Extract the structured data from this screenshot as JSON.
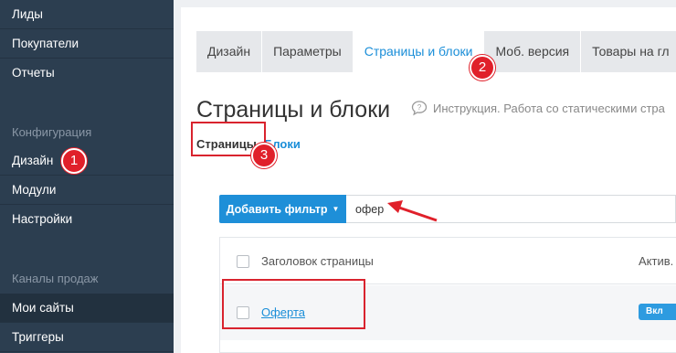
{
  "sidebar": {
    "items_top": [
      {
        "label": "Лиды"
      },
      {
        "label": "Покупатели"
      },
      {
        "label": "Отчеты"
      }
    ],
    "section_config": "Конфигурация",
    "items_config": [
      {
        "label": "Дизайн"
      },
      {
        "label": "Модули"
      },
      {
        "label": "Настройки"
      }
    ],
    "section_channels": "Каналы продаж",
    "items_channels": [
      {
        "label": "Мои сайты"
      },
      {
        "label": "Триггеры"
      }
    ]
  },
  "tabs": [
    {
      "label": "Дизайн"
    },
    {
      "label": "Параметры"
    },
    {
      "label": "Страницы и блоки"
    },
    {
      "label": "Моб. версия"
    },
    {
      "label": "Товары на гл"
    }
  ],
  "page": {
    "title": "Страницы и блоки",
    "help_text": "Инструкция. Работа со статическими стра"
  },
  "subtabs": {
    "pages": "Страницы",
    "blocks": "Блоки"
  },
  "filter": {
    "add_button": "Добавить фильтр",
    "search_value": "офер"
  },
  "table": {
    "col_title": "Заголовок страницы",
    "col_active": "Актив.",
    "rows": [
      {
        "title": "Оферта",
        "status": "Вкл"
      }
    ]
  },
  "annotations": {
    "badge1": "1",
    "badge2": "2",
    "badge3": "3",
    "color": "#e0202a"
  }
}
